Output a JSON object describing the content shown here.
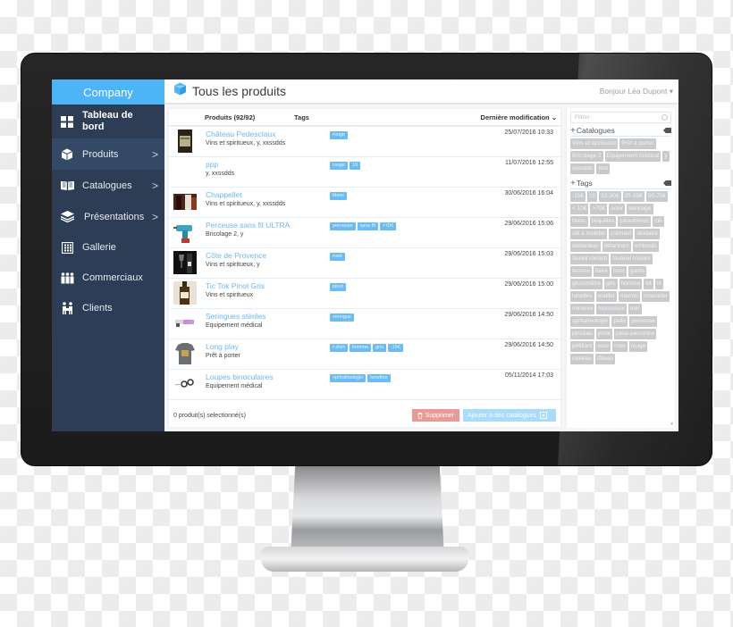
{
  "sidebar": {
    "brand": "Company",
    "items": [
      {
        "label": "Tableau de bord",
        "icon": "dashboard-grid-icon",
        "chevron": false
      },
      {
        "label": "Produits",
        "icon": "cube-icon",
        "chevron": true,
        "active": true
      },
      {
        "label": "Catalogues",
        "icon": "open-book-icon",
        "chevron": true
      },
      {
        "label": "Présentations",
        "icon": "layers-icon",
        "chevron": true
      },
      {
        "label": "Gallerie",
        "icon": "gallery-icon",
        "chevron": false
      },
      {
        "label": "Commerciaux",
        "icon": "team-icon",
        "chevron": false
      },
      {
        "label": "Clients",
        "icon": "clients-icon",
        "chevron": false
      }
    ],
    "chevron_glyph": ">"
  },
  "header": {
    "title": "Tous les produits",
    "user_greeting": "Bonjour Léa Dupont ▾"
  },
  "table": {
    "columns": {
      "products": "Produits (92/92)",
      "tags": "Tags",
      "date": "Dernière modification ⌄"
    },
    "rows": [
      {
        "name": "Château Pedesclaux",
        "sub": "Vins et spiritueux, y, xxssdds",
        "tags": [
          "rouge"
        ],
        "date": "25/07/2016 10:33",
        "thumb": "wine-bottle-label"
      },
      {
        "name": "ppp",
        "sub": "y, xxssdds",
        "tags": [
          "rouge",
          "10"
        ],
        "date": "11/07/2016 12:55",
        "thumb": "none"
      },
      {
        "name": "Chappellet",
        "sub": "Vins et spiritueux, y, xxssdds",
        "tags": [
          "blanc"
        ],
        "date": "30/06/2016 16:04",
        "thumb": "wine-bottles"
      },
      {
        "name": "Perceuse sans fil ULTRA",
        "sub": "Bricolage 2, y",
        "tags": [
          "perceuse",
          "sans fil",
          ">70€"
        ],
        "date": "29/06/2016 15:06",
        "thumb": "drill"
      },
      {
        "name": "Côte de Provence",
        "sub": "Vins et spiritueux, y",
        "tags": [
          "rosé"
        ],
        "date": "29/06/2016 15:03",
        "thumb": "wine-glass-dark"
      },
      {
        "name": "Tic Tok Pinot Gris",
        "sub": "Vins et spiritueux",
        "tags": [
          "pinot"
        ],
        "date": "29/06/2016 15:00",
        "thumb": "wine-bottle"
      },
      {
        "name": "Seringues stériles",
        "sub": "Equipement médical",
        "tags": [
          "seringue"
        ],
        "date": "29/06/2016 14:50",
        "thumb": "syringe"
      },
      {
        "name": "Long play",
        "sub": "Prêt à porter",
        "tags": [
          "t-shirt",
          "homme",
          "gris",
          "-15€"
        ],
        "date": "29/06/2016 14:50",
        "thumb": "tshirt"
      },
      {
        "name": "Loupes binoculaires",
        "sub": "Equipement médical",
        "tags": [
          "ophtalmologie",
          "lunettes"
        ],
        "date": "05/11/2014 17:03",
        "thumb": "glasses"
      }
    ],
    "footer": {
      "selected_count": "0 produit(s) selectionné(s)",
      "delete_label": "Supprimer",
      "add_label": "Ajouter à des catalogues"
    }
  },
  "filters": {
    "placeholder": "Filtrer",
    "catalogues_title": "Catalogues",
    "catalogues": [
      "Vins et spiritueux",
      "Prêt à porter",
      "Bricolage 2",
      "Equipement médical",
      "y",
      "xxssdds",
      "test"
    ],
    "tags_title": "Tags",
    "tags": [
      "-15€",
      "10",
      "10-30€",
      "25-35€",
      "50-70€",
      "< 10€",
      ">70€",
      "acier",
      "bandage",
      "blanc",
      "béquilles",
      "caoutchouc",
      "clé",
      "clé à molette",
      "crémant",
      "dentaire",
      "débardeur",
      "détartreur",
      "embouts",
      "fauteil roulant",
      "fauteuil roulant",
      "femme",
      "flaire",
      "foret",
      "gants",
      "glucomètre",
      "gris",
      "homme",
      "kit",
      "lit",
      "lunettes",
      "maillet",
      "marron",
      "massette",
      "minerve",
      "mousseux",
      "noir",
      "ophtalmologie",
      "pelle",
      "perceuse",
      "pinceau",
      "pinot",
      "pèse-personne",
      "pétillant",
      "rose",
      "rosé",
      "rouge",
      "rouleau",
      "râteau"
    ]
  },
  "colors": {
    "brand": "#4db5f5",
    "sidebar_bg": "#2c3d55",
    "link": "#6bb8f0",
    "tag_bg": "#6cbcf3",
    "delete_btn": "#e99a95",
    "add_btn": "#a9dbfa",
    "chip_bg": "#c9cacc"
  }
}
